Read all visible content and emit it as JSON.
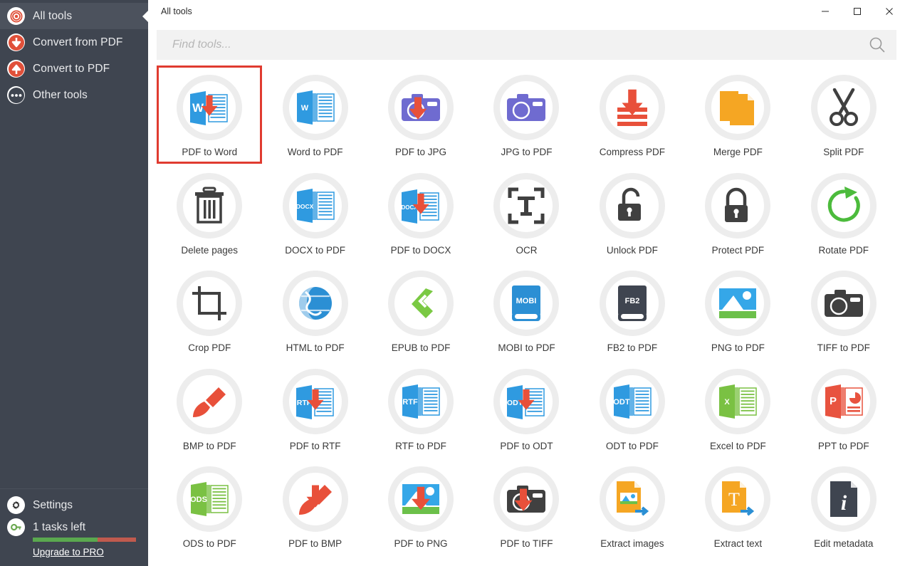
{
  "window": {
    "title": "All tools",
    "minimize_label": "–",
    "maximize_label": "□",
    "close_label": "✕"
  },
  "sidebar": {
    "items": [
      {
        "label": "All tools",
        "icon": "spiral-icon",
        "active": true
      },
      {
        "label": "Convert from PDF",
        "icon": "arrow-down-circle-icon",
        "active": false
      },
      {
        "label": "Convert to PDF",
        "icon": "arrow-up-circle-icon",
        "active": false
      },
      {
        "label": "Other tools",
        "icon": "ellipsis-icon",
        "active": false
      }
    ],
    "footer": {
      "settings_label": "Settings",
      "settings_icon": "gear-icon",
      "tasks_label": "1 tasks left",
      "tasks_icon": "key-icon",
      "upgrade_label": "Upgrade to PRO",
      "progress_percent": 63,
      "progress_color_done": "#5aa84f",
      "progress_color_left": "#c05a4e"
    },
    "background_color": "#3f4550",
    "active_background_color": "#4c525d"
  },
  "search": {
    "placeholder": "Find tools...",
    "value": "",
    "icon": "search-icon"
  },
  "accent_color": "#e03b30",
  "tools": [
    {
      "label": "PDF to Word",
      "icon": "pdf-to-word-icon",
      "selected": true
    },
    {
      "label": "Word to PDF",
      "icon": "word-to-pdf-icon",
      "selected": false
    },
    {
      "label": "PDF to JPG",
      "icon": "pdf-to-jpg-icon",
      "selected": false
    },
    {
      "label": "JPG to PDF",
      "icon": "jpg-to-pdf-icon",
      "selected": false
    },
    {
      "label": "Compress PDF",
      "icon": "compress-pdf-icon",
      "selected": false
    },
    {
      "label": "Merge PDF",
      "icon": "merge-pdf-icon",
      "selected": false
    },
    {
      "label": "Split PDF",
      "icon": "scissors-icon",
      "selected": false
    },
    {
      "label": "Delete pages",
      "icon": "trash-icon",
      "selected": false
    },
    {
      "label": "DOCX to PDF",
      "icon": "docx-to-pdf-icon",
      "selected": false
    },
    {
      "label": "PDF to DOCX",
      "icon": "pdf-to-docx-icon",
      "selected": false
    },
    {
      "label": "OCR",
      "icon": "ocr-icon",
      "selected": false
    },
    {
      "label": "Unlock PDF",
      "icon": "unlock-icon",
      "selected": false
    },
    {
      "label": "Protect PDF",
      "icon": "lock-icon",
      "selected": false
    },
    {
      "label": "Rotate PDF",
      "icon": "rotate-icon",
      "selected": false
    },
    {
      "label": "Crop PDF",
      "icon": "crop-icon",
      "selected": false
    },
    {
      "label": "HTML to PDF",
      "icon": "globe-icon",
      "selected": false
    },
    {
      "label": "EPUB to PDF",
      "icon": "epub-icon",
      "selected": false
    },
    {
      "label": "MOBI to PDF",
      "icon": "mobi-icon",
      "selected": false
    },
    {
      "label": "FB2 to PDF",
      "icon": "fb2-icon",
      "selected": false
    },
    {
      "label": "PNG to PDF",
      "icon": "png-to-pdf-icon",
      "selected": false
    },
    {
      "label": "TIFF to PDF",
      "icon": "camera-icon",
      "selected": false
    },
    {
      "label": "BMP to PDF",
      "icon": "brush-icon",
      "selected": false
    },
    {
      "label": "PDF to RTF",
      "icon": "pdf-to-rtf-icon",
      "selected": false
    },
    {
      "label": "RTF to PDF",
      "icon": "rtf-to-pdf-icon",
      "selected": false
    },
    {
      "label": "PDF to ODT",
      "icon": "pdf-to-odt-icon",
      "selected": false
    },
    {
      "label": "ODT to PDF",
      "icon": "odt-to-pdf-icon",
      "selected": false
    },
    {
      "label": "Excel to PDF",
      "icon": "excel-icon",
      "selected": false
    },
    {
      "label": "PPT to PDF",
      "icon": "powerpoint-icon",
      "selected": false
    },
    {
      "label": "ODS to PDF",
      "icon": "ods-icon",
      "selected": false
    },
    {
      "label": "PDF to BMP",
      "icon": "pdf-to-bmp-icon",
      "selected": false
    },
    {
      "label": "PDF to PNG",
      "icon": "pdf-to-png-icon",
      "selected": false
    },
    {
      "label": "PDF to TIFF",
      "icon": "pdf-to-tiff-icon",
      "selected": false
    },
    {
      "label": "Extract images",
      "icon": "extract-images-icon",
      "selected": false
    },
    {
      "label": "Extract text",
      "icon": "extract-text-icon",
      "selected": false
    },
    {
      "label": "Edit metadata",
      "icon": "edit-metadata-icon",
      "selected": false
    }
  ]
}
